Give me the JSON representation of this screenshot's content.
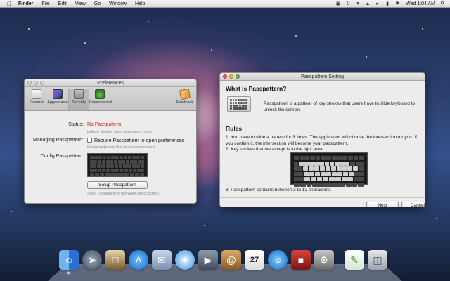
{
  "menubar": {
    "apple": "",
    "items": [
      "Finder",
      "File",
      "Edit",
      "View",
      "Go",
      "Window",
      "Help"
    ],
    "clock": "Wed 1:04 AM",
    "status_icons": [
      "lock-icon",
      "sync-icon",
      "bluetooth-icon",
      "wifi-icon",
      "volume-icon",
      "battery-icon",
      "flag-icon"
    ]
  },
  "prefs": {
    "title": "Preferences",
    "toolbar": [
      {
        "label": "General",
        "icon": "general-icon"
      },
      {
        "label": "Appearance",
        "icon": "appearance-icon"
      },
      {
        "label": "Security",
        "icon": "security-icon"
      },
      {
        "label": "Experimental",
        "icon": "experimental-icon"
      }
    ],
    "feedback_label": "Feedback",
    "status_label": "Status:",
    "status_value": "No Passpattern",
    "status_hint": "Indicate whether using passpattern or not.",
    "managing_label": "Managing Passpattern:",
    "managing_checkbox": "Require Passpattern to open preferences",
    "managing_hint": "Please make sure that you can remember it.",
    "config_label": "Config Passpattern:",
    "setup_button": "Setup Passpattern",
    "setup_hint": "Setup Passpattern to use when unlock screen."
  },
  "pass": {
    "title": "Passpattern Setting",
    "what_heading": "What is Passpattern?",
    "intro": "Passpattern is a pattern of key strokes that users have to slide keyboard  to unlock the screen.",
    "rules_heading": "Rules",
    "rule1": "1. You have to slide a pattern for 3 times. The application will choose the intersection for you. If you confirm it, the intersection will become your passpattern.",
    "rule2": "2. Key strokes that we accept is in the light area.",
    "rule3": "3. Passpattern contains between 3 to 12 characters.",
    "next_button": "Next",
    "cancel_button": "Cancel"
  },
  "dock": {
    "apps": [
      "finder-icon",
      "launchpad-icon",
      "photo-icon",
      "app-store-icon",
      "mail-icon",
      "safari-icon",
      "facetime-icon",
      "contacts-icon",
      "calendar-icon",
      "itunes-icon",
      "photo-booth-icon",
      "system-preferences-icon",
      "preview-icon",
      "trash-icon"
    ],
    "calendar_day": "27"
  }
}
